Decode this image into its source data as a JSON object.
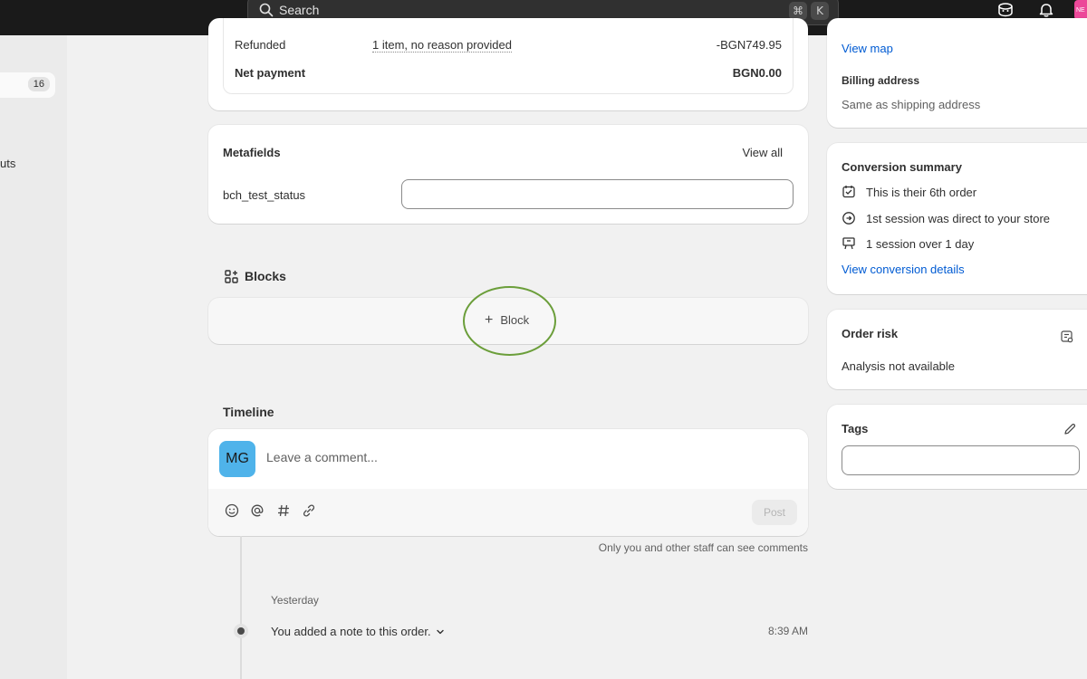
{
  "topbar": {
    "search_placeholder": "Search",
    "shortcut_cmd": "⌘",
    "shortcut_key": "K",
    "avatar_initials": "NE"
  },
  "sidebar": {
    "item_badge": "16",
    "partial_label": "uts"
  },
  "payment": {
    "refunded_label": "Refunded",
    "refunded_desc": "1 item, no reason provided",
    "refunded_amount": "-BGN749.95",
    "net_label": "Net payment",
    "net_amount": "BGN0.00"
  },
  "metafields": {
    "title": "Metafields",
    "view_all": "View all",
    "key": "bch_test_status",
    "value": ""
  },
  "blocks": {
    "title": "Blocks",
    "add_label": "Block"
  },
  "timeline": {
    "title": "Timeline",
    "avatar_initials": "MG",
    "comment_placeholder": "Leave a comment...",
    "post_label": "Post",
    "staff_note": "Only you and other staff can see comments",
    "day_label": "Yesterday",
    "event_text": "You added a note to this order.",
    "event_time": "8:39 AM"
  },
  "address": {
    "view_map": "View map",
    "billing_title": "Billing address",
    "billing_value": "Same as shipping address"
  },
  "conversion": {
    "title": "Conversion summary",
    "rows": [
      "This is their 6th order",
      "1st session was direct to your store",
      "1 session over 1 day"
    ],
    "details_link": "View conversion details"
  },
  "risk": {
    "title": "Order risk",
    "value": "Analysis not available"
  },
  "tags": {
    "title": "Tags",
    "value": ""
  },
  "colors": {
    "accent_link": "#005bd3",
    "highlight_ring": "#6b9e3a",
    "avatar_mg": "#4fb3ea",
    "avatar_top": "#ec4899"
  }
}
